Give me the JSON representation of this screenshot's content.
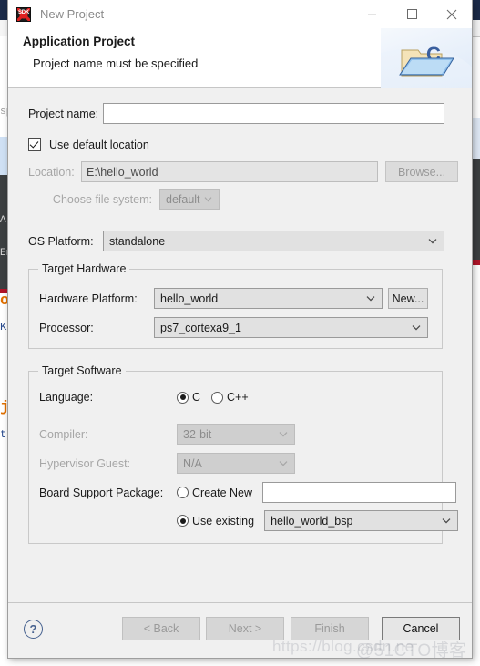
{
  "window": {
    "title": "New Project",
    "app_icon": "sdk-icon",
    "controls": {
      "minimize": "—",
      "maximize": "□",
      "close": "✕"
    }
  },
  "header": {
    "title": "Application Project",
    "message": "Project name must be specified",
    "art_icon": "folder-c-icon"
  },
  "form": {
    "project_name": {
      "label": "Project name:",
      "value": "",
      "placeholder": ""
    },
    "use_default_location": {
      "label": "Use default location",
      "checked": true
    },
    "location": {
      "label": "Location:",
      "value": "E:\\hello_world",
      "enabled": false
    },
    "browse_button": {
      "label": "Browse...",
      "enabled": false
    },
    "file_system": {
      "label": "Choose file system:",
      "value": "default",
      "enabled": false
    },
    "os_platform": {
      "label": "OS Platform:",
      "value": "standalone"
    }
  },
  "target_hardware": {
    "legend": "Target Hardware",
    "hardware_platform": {
      "label": "Hardware Platform:",
      "value": "hello_world"
    },
    "new_button": {
      "label": "New..."
    },
    "processor": {
      "label": "Processor:",
      "value": "ps7_cortexa9_1"
    }
  },
  "target_software": {
    "legend": "Target Software",
    "language": {
      "label": "Language:",
      "options": [
        {
          "label": "C",
          "selected": true
        },
        {
          "label": "C++",
          "selected": false
        }
      ]
    },
    "compiler": {
      "label": "Compiler:",
      "value": "32-bit",
      "enabled": false
    },
    "hypervisor_guest": {
      "label": "Hypervisor Guest:",
      "value": "N/A",
      "enabled": false
    },
    "board_support_package": {
      "label": "Board Support Package:",
      "create_new": {
        "label": "Create New",
        "selected": false,
        "value": ""
      },
      "use_existing": {
        "label": "Use existing",
        "selected": true,
        "value": "hello_world_bsp"
      }
    }
  },
  "footer": {
    "help_icon": "?",
    "buttons": [
      {
        "label": "< Back",
        "enabled": false
      },
      {
        "label": "Next >",
        "enabled": false
      },
      {
        "label": "Finish",
        "enabled": false
      },
      {
        "label": "Cancel",
        "enabled": true
      }
    ]
  },
  "watermarks": {
    "csdn": "https://blog.csdn.ne",
    "cto": "@51CTO博客"
  },
  "backdrop": {
    "fragments": [
      {
        "text": "sp",
        "style": "gray"
      },
      {
        "text": "A",
        "style": "white"
      },
      {
        "text": "En",
        "style": "white"
      },
      {
        "text": "ol",
        "style": "orange"
      },
      {
        "text": "K",
        "style": "blue"
      },
      {
        "text": "je",
        "style": "orange"
      },
      {
        "text": "t",
        "style": "blue"
      }
    ]
  },
  "colors": {
    "dialog_bg": "#f0f0f0",
    "accent_blue": "#46618f",
    "ide_titlebar": "#1b2a48",
    "ide_editor": "#3c3f41",
    "error_red": "#b01428",
    "orange": "#e07000"
  }
}
